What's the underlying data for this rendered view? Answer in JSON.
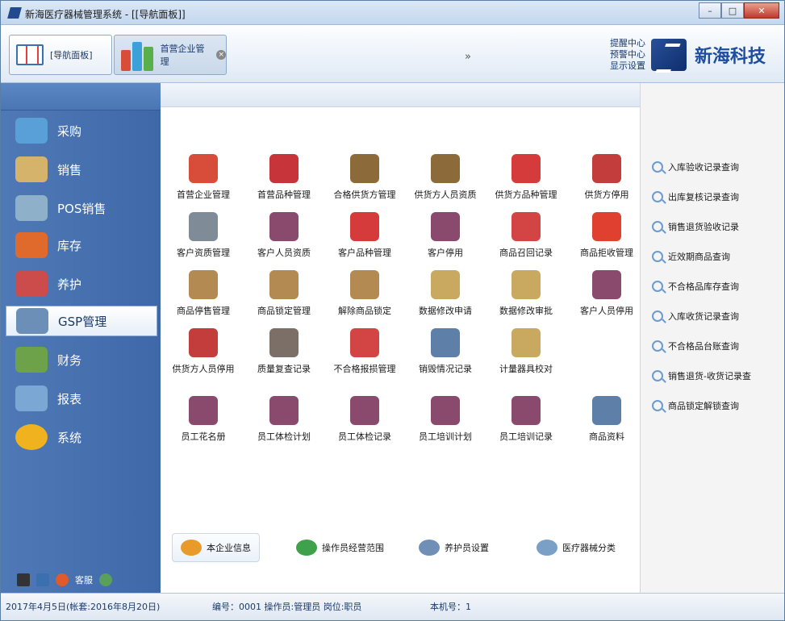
{
  "window": {
    "title": "新海医疗器械管理系统 - [[导航面板]]",
    "min": "–",
    "max": "□",
    "close": "✕"
  },
  "tabs": [
    {
      "label": "[导航面板]"
    },
    {
      "label": "首营企业管理",
      "close": "×"
    }
  ],
  "toolbar": {
    "chevron": "»",
    "links": [
      "提醒中心",
      "预警中心",
      "显示设置"
    ],
    "brand": "新海科技"
  },
  "sidebar": {
    "items": [
      {
        "label": "采购",
        "color": "#5aa0d8"
      },
      {
        "label": "销售",
        "color": "#d6b36a"
      },
      {
        "label": "POS销售",
        "color": "#8fb0c9"
      },
      {
        "label": "库存",
        "color": "#e06a2b"
      },
      {
        "label": "养护",
        "color": "#cc4b4b"
      },
      {
        "label": "GSP管理",
        "color": "#6c8fb8"
      },
      {
        "label": "财务",
        "color": "#6ea24a"
      },
      {
        "label": "报表",
        "color": "#7ba7d4"
      },
      {
        "label": "系统",
        "color": "#f0b21e"
      }
    ],
    "footer": {
      "service": "客服"
    }
  },
  "grid": [
    [
      {
        "label": "首营企业管理",
        "color": "#d84c3a"
      },
      {
        "label": "首营品种管理",
        "color": "#c7343a"
      },
      {
        "label": "合格供货方管理",
        "color": "#8d6a3a"
      },
      {
        "label": "供货方人员资质",
        "color": "#8d6a3a"
      },
      {
        "label": "供货方品种管理",
        "color": "#d53b3b"
      },
      {
        "label": "供货方停用",
        "color": "#c43d3d"
      }
    ],
    [
      {
        "label": "客户资质管理",
        "color": "#7f8b96"
      },
      {
        "label": "客户人员资质",
        "color": "#8a4a6e"
      },
      {
        "label": "客户品种管理",
        "color": "#d53b3b"
      },
      {
        "label": "客户停用",
        "color": "#8a4a6e"
      },
      {
        "label": "商品召回记录",
        "color": "#d34545"
      },
      {
        "label": "商品拒收管理",
        "color": "#e0402f"
      }
    ],
    [
      {
        "label": "商品停售管理",
        "color": "#b38a52"
      },
      {
        "label": "商品锁定管理",
        "color": "#b38a52"
      },
      {
        "label": "解除商品锁定",
        "color": "#b38a52"
      },
      {
        "label": "数据修改申请",
        "color": "#c9a860"
      },
      {
        "label": "数据修改审批",
        "color": "#c9a860"
      },
      {
        "label": "客户人员停用",
        "color": "#8a4a6e"
      }
    ],
    [
      {
        "label": "供货方人员停用",
        "color": "#c43d3d"
      },
      {
        "label": "质量复查记录",
        "color": "#7c6f68"
      },
      {
        "label": "不合格报损管理",
        "color": "#d34545"
      },
      {
        "label": "销毁情况记录",
        "color": "#5e7fa8"
      },
      {
        "label": "计量器具校对",
        "color": "#c9a860"
      }
    ],
    [
      {
        "label": "员工花名册",
        "color": "#8a4a6e"
      },
      {
        "label": "员工体检计划",
        "color": "#8a4a6e"
      },
      {
        "label": "员工体检记录",
        "color": "#8a4a6e"
      },
      {
        "label": "员工培训计划",
        "color": "#8a4a6e"
      },
      {
        "label": "员工培训记录",
        "color": "#8a4a6e"
      },
      {
        "label": "商品资料",
        "color": "#5e7fa8"
      }
    ]
  ],
  "bottom": [
    {
      "label": "本企业信息",
      "color": "#e89a2a"
    },
    {
      "label": "操作员经营范围",
      "color": "#3fa24a"
    },
    {
      "label": "养护员设置",
      "color": "#6f8fb7"
    },
    {
      "label": "医疗器械分类",
      "color": "#7aa0c8"
    }
  ],
  "right_links": [
    "入库验收记录查询",
    "出库复核记录查询",
    "销售退货验收记录",
    "近效期商品查询",
    "不合格品库存查询",
    "入库收货记录查询",
    "不合格品台账查询",
    "销售退货-收货记录查",
    "商品锁定解锁查询"
  ],
  "status": {
    "date": "2017年4月5日(帐套:2016年8月20日)",
    "operator": "编号：0001 操作员:管理员 岗位:职员",
    "machine": "本机号：1"
  }
}
